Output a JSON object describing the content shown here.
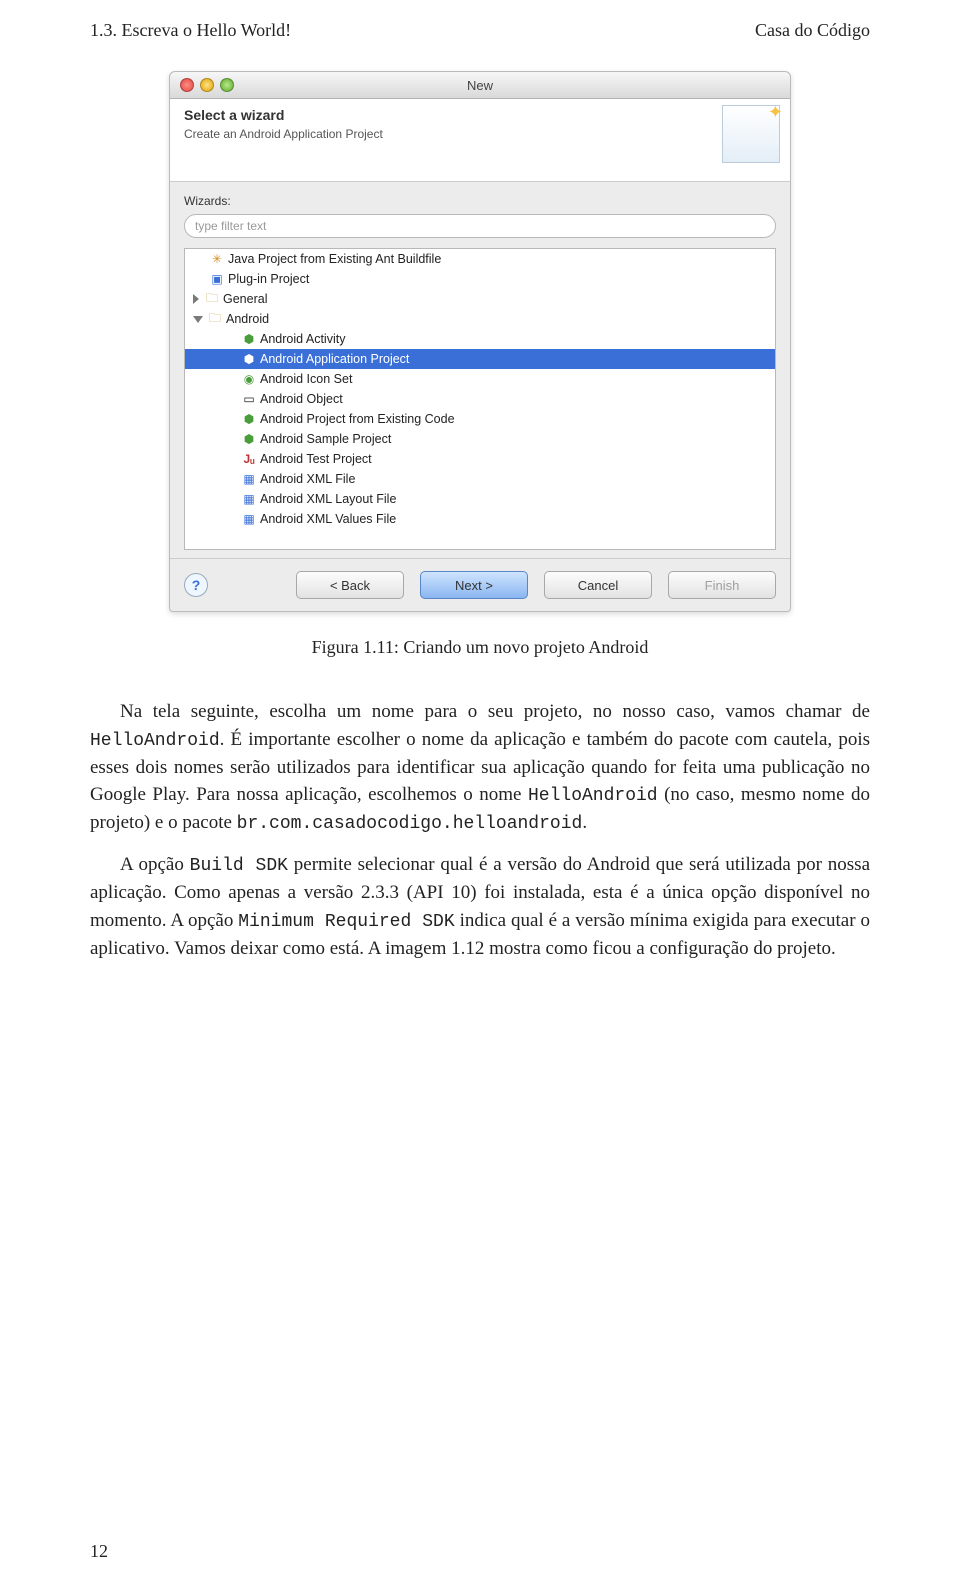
{
  "header": {
    "left": "1.3. Escreva o Hello World!",
    "right": "Casa do Código"
  },
  "dialog": {
    "window_title": "New",
    "banner_title": "Select a wizard",
    "banner_subtitle": "Create an Android Application Project",
    "wizards_label": "Wizards:",
    "filter_placeholder": "type filter text",
    "tree": {
      "top": [
        {
          "label": "Java Project from Existing Ant Buildfile"
        },
        {
          "label": "Plug-in Project"
        }
      ],
      "general": "General",
      "android": "Android",
      "android_children": [
        "Android Activity",
        "Android Application Project",
        "Android Icon Set",
        "Android Object",
        "Android Project from Existing Code",
        "Android Sample Project",
        "Android Test Project",
        "Android XML File",
        "Android XML Layout File",
        "Android XML Values File"
      ],
      "selected_index": 1
    },
    "buttons": {
      "back": "< Back",
      "next": "Next >",
      "cancel": "Cancel",
      "finish": "Finish"
    }
  },
  "caption": "Figura 1.11: Criando um novo projeto Android",
  "body": {
    "p1_a": "Na tela seguinte, escolha um nome para o seu projeto, no nosso caso, vamos chamar de ",
    "p1_code": "HelloAndroid",
    "p1_b": ". É importante escolher o nome da aplicação e também do pacote com cautela, pois esses dois nomes serão utilizados para identificar sua aplicação quando for feita uma publicação no Google Play. Para nossa aplicação, escolhemos o nome ",
    "p1_code2": "HelloAndroid",
    "p1_c": " (no caso, mesmo nome do projeto) e o pacote ",
    "p1_code3": "br.com.casadocodigo.helloandroid",
    "p1_d": ".",
    "p2_a": "A opção ",
    "p2_code1": "Build SDK",
    "p2_b": " permite selecionar qual é a versão do Android que será utilizada por nossa aplicação. Como apenas a versão 2.3.3 (API 10) foi instalada, esta é a única opção disponível no momento. A opção ",
    "p2_code2": "Minimum Required SDK",
    "p2_c": " indica qual é a versão mínima exigida para executar o aplicativo. Vamos deixar como está. A imagem 1.12 mostra como ficou a configuração do projeto."
  },
  "page_number": "12"
}
